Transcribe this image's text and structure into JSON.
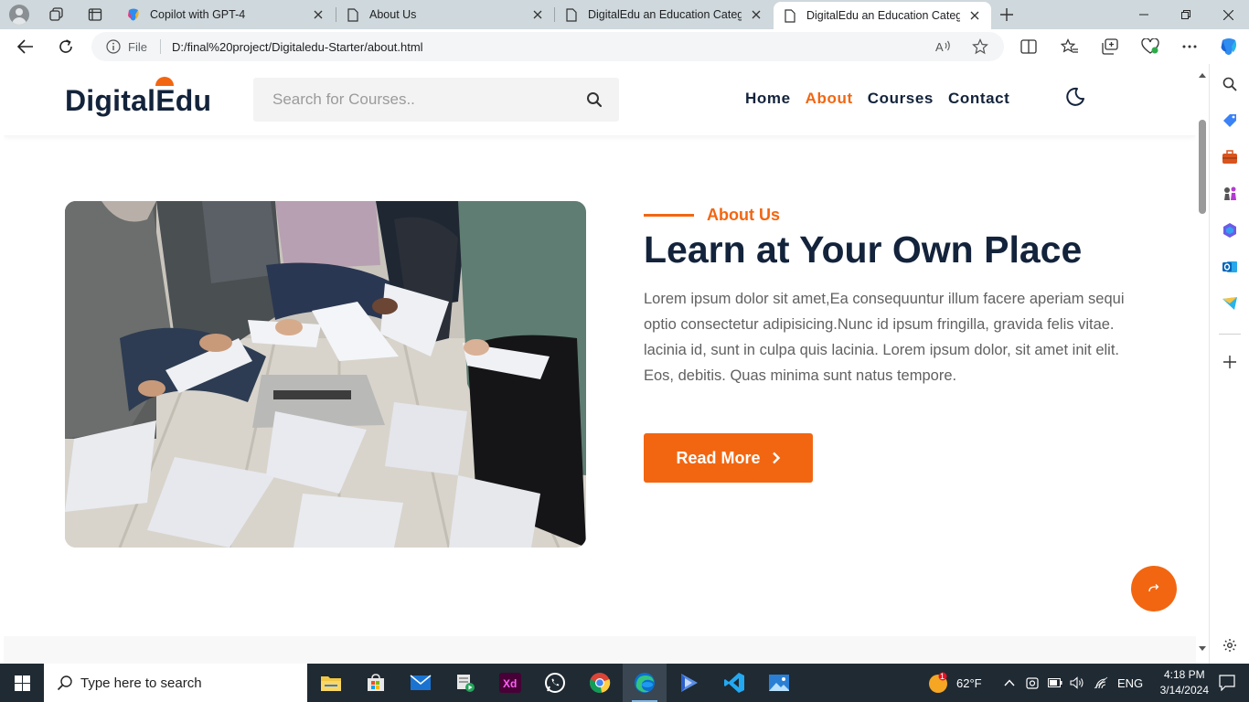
{
  "browser": {
    "tabs": [
      {
        "title": "Copilot with GPT-4",
        "active": false
      },
      {
        "title": "About Us",
        "active": false
      },
      {
        "title": "DigitalEdu an Education Category",
        "active": false
      },
      {
        "title": "DigitalEdu an Education Category",
        "active": true
      }
    ],
    "address": {
      "scheme_label": "File",
      "url": "D:/final%20project/Digitaledu-Starter/about.html"
    }
  },
  "site": {
    "logo": {
      "part1": "Digital",
      "part2": "Edu"
    },
    "search": {
      "placeholder": "Search for Courses.."
    },
    "nav": [
      {
        "label": "Home",
        "active": false
      },
      {
        "label": "About",
        "active": true
      },
      {
        "label": "Courses",
        "active": false
      },
      {
        "label": "Contact",
        "active": false
      }
    ]
  },
  "hero": {
    "subtitle": "About Us",
    "heading": "Learn at Your Own Place",
    "paragraph": "Lorem ipsum dolor sit amet,Ea consequuntur illum facere aperiam sequi optio consectetur adipisicing.Nunc id ipsum fringilla, gravida felis vitae. lacinia id, sunt in culpa quis lacinia. Lorem ipsum dolor, sit amet init elit. Eos, debitis. Quas minima sunt natus tempore.",
    "button": "Read More"
  },
  "taskbar": {
    "search_placeholder": "Type here to search",
    "weather": "62°F",
    "weather_badge": "1",
    "language": "ENG",
    "time": "4:18 PM",
    "date": "3/14/2024"
  },
  "colors": {
    "accent": "#f26611",
    "heading": "#13233b",
    "body_text": "#616161"
  }
}
